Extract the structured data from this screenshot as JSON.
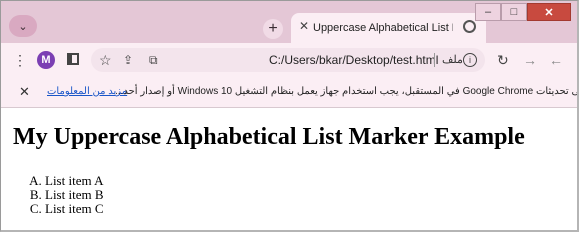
{
  "browser": {
    "tab_title": "Uppercase Alphabetical List Mar",
    "address": "C:/Users/bkar/Desktop/test.html",
    "site_info_label": "ملف",
    "profile_initial": "M"
  },
  "infobar": {
    "message": "للحصول على تحديثات Google Chrome في المستقبل، يجب استخدام جهاز يعمل بنظام التشغيل Windows 10 أو إصدار أحد...",
    "link": "مزيد من المعلومات"
  },
  "page": {
    "heading": "My Uppercase Alphabetical List Marker Example",
    "list_items": [
      "List item A",
      "List item B",
      "List item C"
    ]
  },
  "colors": {
    "titlebar": "#e4c7d6",
    "toolbar": "#fbeef4",
    "profile": "#7b3fb3",
    "link": "#1a56c8"
  },
  "icons": [
    "chevron-down-icon",
    "new-tab-icon",
    "close-icon",
    "globe-icon",
    "minimize-icon",
    "maximize-icon",
    "window-close-icon",
    "menu-icon",
    "side-panel-icon",
    "star-icon",
    "share-icon",
    "extension-icon",
    "info-icon",
    "reload-icon",
    "back-icon",
    "forward-icon"
  ]
}
